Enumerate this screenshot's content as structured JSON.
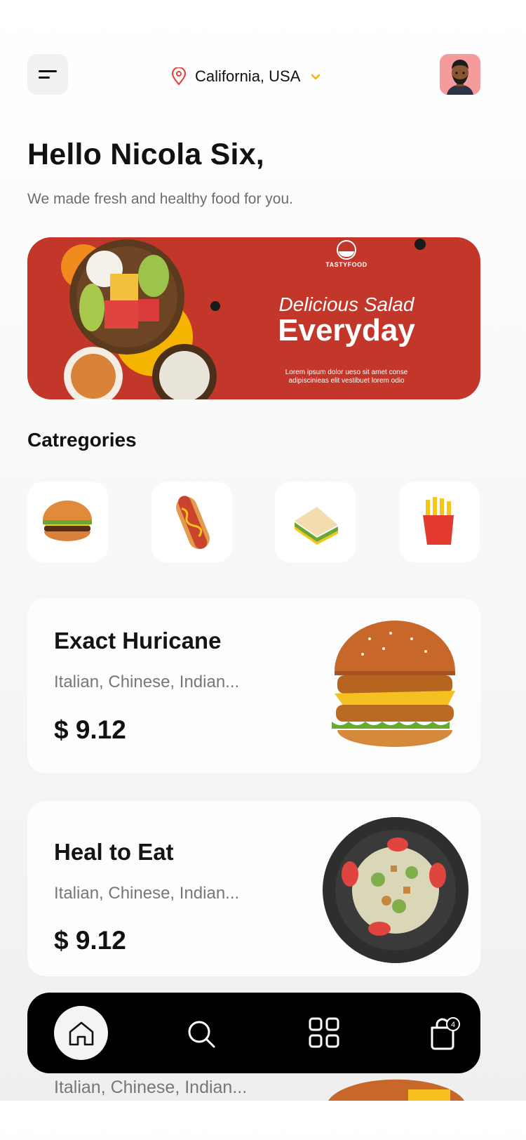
{
  "header": {
    "menu_icon": "menu-icon",
    "location_icon": "location-pin-icon",
    "location": "California, USA",
    "dropdown_icon": "chevron-down-icon",
    "avatar": "avatar"
  },
  "greeting": {
    "title": "Hello Nicola Six,",
    "subtitle": "We made fresh and healthy food for you."
  },
  "banner": {
    "brand": "TASTYFOOD",
    "line1": "Delicious Salad",
    "line2": "Everyday",
    "description": "Lorem ipsum dolor ueso sit amet conse adipiscinieas elit vestibuet lorem odio"
  },
  "categories": {
    "title": "Catregories",
    "items": [
      {
        "icon": "burger-icon"
      },
      {
        "icon": "hotdog-icon"
      },
      {
        "icon": "sandwich-icon"
      },
      {
        "icon": "fries-icon"
      }
    ]
  },
  "products": [
    {
      "name": "Exact Huricane",
      "cuisine": "Italian, Chinese, Indian...",
      "price": "$ 9.12",
      "image": "burger-image"
    },
    {
      "name": "Heal to Eat",
      "cuisine": "Italian, Chinese, Indian...",
      "price": "$ 9.12",
      "image": "salad-plate-image"
    },
    {
      "cuisine": "Italian, Chinese, Indian...",
      "image": "burger-image"
    }
  ],
  "nav": {
    "items": [
      "home-icon",
      "search-icon",
      "grid-icon",
      "cart-icon"
    ],
    "cart_badge": "4"
  },
  "colors": {
    "accent_red": "#C2372A",
    "pin_red": "#E8453C",
    "chevron_yellow": "#F5B400",
    "nav_bg": "#000000"
  }
}
